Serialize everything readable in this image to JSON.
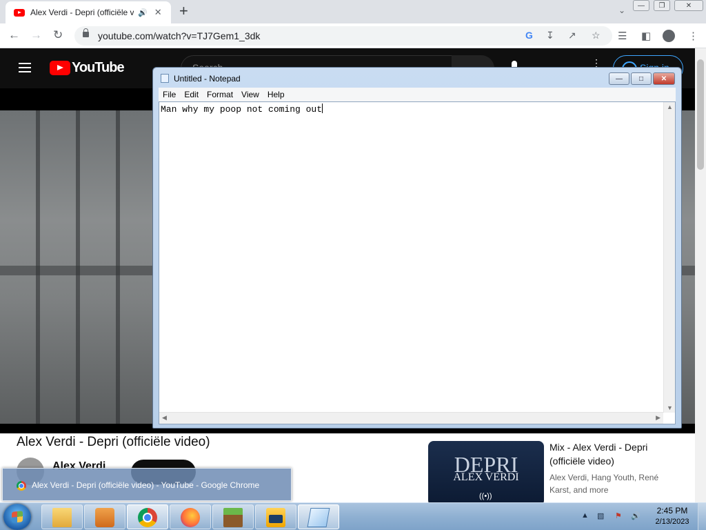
{
  "browser": {
    "tab_title": "Alex Verdi - Depri (officiële video) - YouTube",
    "new_tab": "+",
    "url": "youtube.com/watch?v=TJ7Gem1_3dk"
  },
  "youtube": {
    "logo_text": "YouTube",
    "search_placeholder": "Search",
    "signin_label": "Sign in",
    "video_title": "Alex Verdi - Depri (officiële video)",
    "channel_name": "Alex Verdi",
    "mix": {
      "thumb_title": "DEPRI",
      "thumb_artist": "ALEX VERDI",
      "title": "Mix - Alex Verdi - Depri (officiële video)",
      "meta": "Alex Verdi, Hang Youth, René Karst, and more"
    }
  },
  "notepad": {
    "title": "Untitled - Notepad",
    "menu": [
      "File",
      "Edit",
      "Format",
      "View",
      "Help"
    ],
    "content": "Man why my poop not coming out"
  },
  "taskbar": {
    "tooltip": "Alex Verdi - Depri (officiële video) - YouTube - Google Chrome",
    "time": "2:45 PM",
    "date": "2/13/2023",
    "items": [
      "explorer-icon",
      "media-player-icon",
      "chrome-icon",
      "firefox-icon",
      "minecraft-icon",
      "toolbox-icon",
      "notepad-icon"
    ]
  }
}
